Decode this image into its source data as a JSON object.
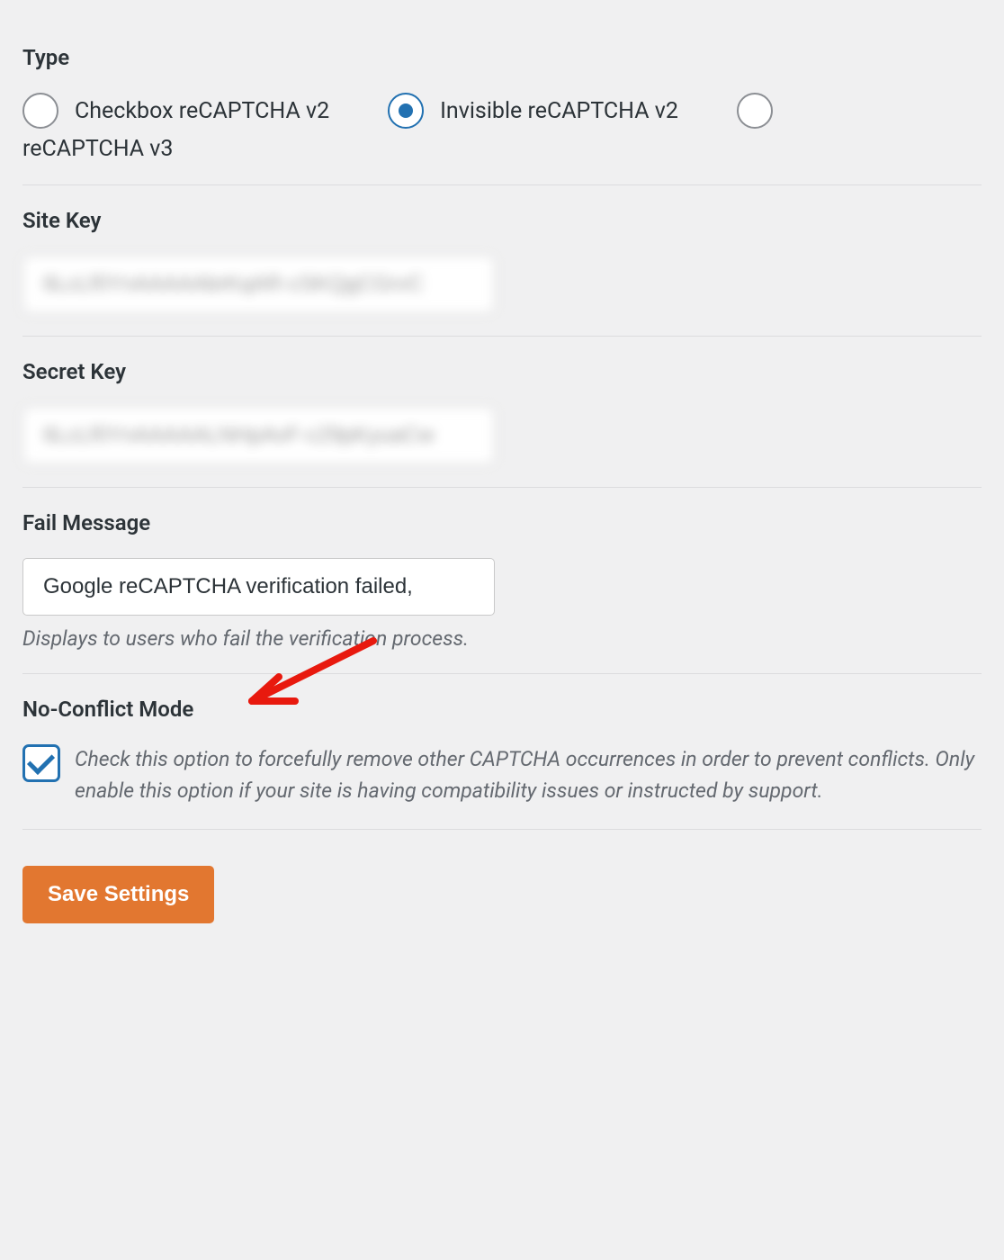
{
  "type_section": {
    "label": "Type",
    "options": {
      "checkbox_v2": "Checkbox reCAPTCHA v2",
      "invisible_v2": "Invisible reCAPTCHA v2",
      "v3": "reCAPTCHA v3"
    },
    "selected": "invisible_v2"
  },
  "site_key": {
    "label": "Site Key",
    "value": "6LcLf0YnAAAAAbrKqAR-cSKQgCGrvC"
  },
  "secret_key": {
    "label": "Secret Key",
    "value": "6LcLf0YnAAAAALNHpAvF-c29pKyuaCw"
  },
  "fail_message": {
    "label": "Fail Message",
    "value": "Google reCAPTCHA verification failed,",
    "help": "Displays to users who fail the verification process."
  },
  "no_conflict": {
    "label": "No-Conflict Mode",
    "description": "Check this option to forcefully remove other CAPTCHA occurrences in order to prevent conflicts. Only enable this option if your site is having compatibility issues or instructed by support.",
    "checked": true
  },
  "save_button": "Save Settings"
}
